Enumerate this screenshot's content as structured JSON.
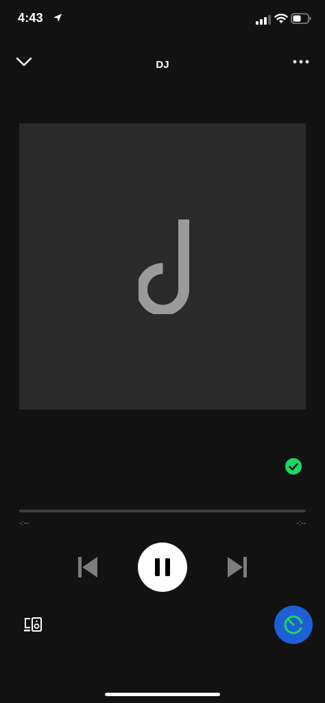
{
  "status_bar": {
    "time": "4:43"
  },
  "header": {
    "title": "DJ"
  },
  "player": {
    "progress_fraction": 0,
    "elapsed": "-:--",
    "remaining": "-:--",
    "state": "playing"
  },
  "colors": {
    "background": "#121212",
    "artwork_bg": "#2a2a2a",
    "logo": "#9a9a9a",
    "liked_green": "#1ed760",
    "dj_button_blue": "#1e5fd6",
    "dj_ring_green": "#1ed760"
  },
  "icons": {
    "status_location": "location-arrow-icon",
    "status_signal": "cellular-signal-icon",
    "status_wifi": "wifi-icon",
    "status_battery": "battery-icon",
    "header_minimize": "chevron-down-icon",
    "header_more": "more-options-icon",
    "artwork": "dj-logo",
    "liked": "checkmark-icon",
    "previous": "skip-previous-icon",
    "pause": "pause-icon",
    "next": "skip-next-icon",
    "devices": "connect-devices-icon",
    "dj": "dj-refresh-icon"
  }
}
